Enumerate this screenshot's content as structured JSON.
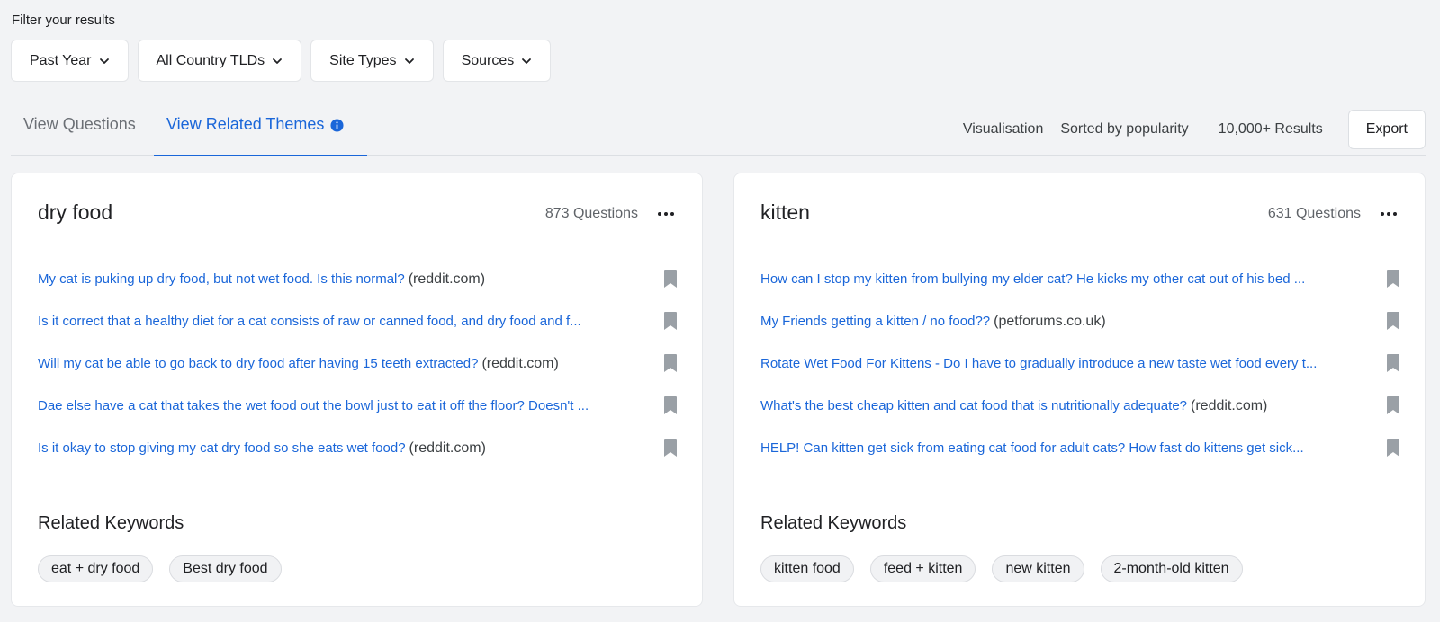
{
  "filters": {
    "label": "Filter your results",
    "buttons": [
      {
        "label": "Past Year"
      },
      {
        "label": "All Country TLDs"
      },
      {
        "label": "Site Types"
      },
      {
        "label": "Sources"
      }
    ]
  },
  "tabs": [
    {
      "label": "View Questions",
      "active": false
    },
    {
      "label": "View Related Themes",
      "active": true
    }
  ],
  "controls": {
    "visualisation": "Visualisation",
    "sort": "Sorted by popularity",
    "results": "10,000+ Results",
    "export": "Export"
  },
  "colors": {
    "accent": "#1a66d9",
    "background": "#f2f3f5",
    "bookmark": "#9aa0a6"
  },
  "cards": [
    {
      "title": "dry food",
      "count": "873 Questions",
      "questions": [
        {
          "text": "My cat is puking up dry food, but not wet food. Is this normal?",
          "source": "(reddit.com)"
        },
        {
          "text": "Is it correct that a healthy diet for a cat consists of raw or canned food, and dry food and f...",
          "source": ""
        },
        {
          "text": "Will my cat be able to go back to dry food after having 15 teeth extracted?",
          "source": "(reddit.com)"
        },
        {
          "text": "Dae else have a cat that takes the wet food out the bowl just to eat it off the floor? Doesn't ...",
          "source": ""
        },
        {
          "text": "Is it okay to stop giving my cat dry food so she eats wet food?",
          "source": "(reddit.com)"
        }
      ],
      "related_title": "Related Keywords",
      "keywords": [
        "eat + dry food",
        "Best dry food"
      ]
    },
    {
      "title": "kitten",
      "count": "631 Questions",
      "questions": [
        {
          "text": "How can I stop my kitten from bullying my elder cat? He kicks my other cat out of his bed ...",
          "source": ""
        },
        {
          "text": "My Friends getting a kitten / no food??",
          "source": "(petforums.co.uk)"
        },
        {
          "text": "Rotate Wet Food For Kittens - Do I have to gradually introduce a new taste wet food every t...",
          "source": ""
        },
        {
          "text": "What's the best cheap kitten and cat food that is nutritionally adequate?",
          "source": "(reddit.com)"
        },
        {
          "text": "HELP! Can kitten get sick from eating cat food for adult cats? How fast do kittens get sick...",
          "source": ""
        }
      ],
      "related_title": "Related Keywords",
      "keywords": [
        "kitten food",
        "feed + kitten",
        "new kitten",
        "2-month-old kitten"
      ]
    }
  ]
}
